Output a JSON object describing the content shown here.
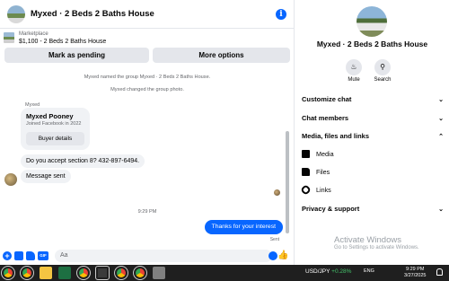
{
  "header": {
    "title": "Myxed · 2 Beds 2 Baths House",
    "info_icon": "i"
  },
  "marketplace": {
    "category": "Marketplace",
    "listing": "$1,100 - 2 Beds 2 Baths House"
  },
  "actions": {
    "mark_pending": "Mark as pending",
    "more_options": "More options"
  },
  "system_messages": [
    "Myxed named the group Myxed · 2 Beds 2 Baths House.",
    "Myxed changed the group photo."
  ],
  "conversation": {
    "sender_label": "Myxed",
    "card": {
      "name": "Myxed Pooney",
      "joined": "Joined Facebook in 2022",
      "button": "Buyer details"
    },
    "incoming": [
      "Do you accept section 8? 432-897-6494.",
      "Message sent"
    ],
    "timestamp": "9:29 PM",
    "outgoing": "Thanks for your interest",
    "status": "Sent"
  },
  "composer": {
    "placeholder": "Aa",
    "gif_label": "GIF",
    "plus_glyph": "+",
    "like_glyph": "👍"
  },
  "info_panel": {
    "group_name": "Myxed · 2 Beds 2 Baths House",
    "mute_label": "Mute",
    "search_label": "Search",
    "mute_icon": "bell-icon",
    "search_icon": "search-icon",
    "sections": {
      "customize": "Customize chat",
      "members": "Chat members",
      "media_files_links": "Media, files and links",
      "privacy": "Privacy & support"
    },
    "sub_items": {
      "media": "Media",
      "files": "Files",
      "links": "Links"
    }
  },
  "watermark": {
    "line1": "Activate Windows",
    "line2": "Go to Settings to activate Windows."
  },
  "taskbar": {
    "ticker_symbol": "USD/JPY",
    "ticker_change": "+0.28%",
    "language": "ENG",
    "time": "9:29 PM",
    "date": "3/27/2025"
  },
  "colors": {
    "accent": "#0866ff",
    "bubble_gray": "#f0f2f5",
    "taskbar": "#1f1f1f",
    "ticker_up": "#44c26b"
  }
}
